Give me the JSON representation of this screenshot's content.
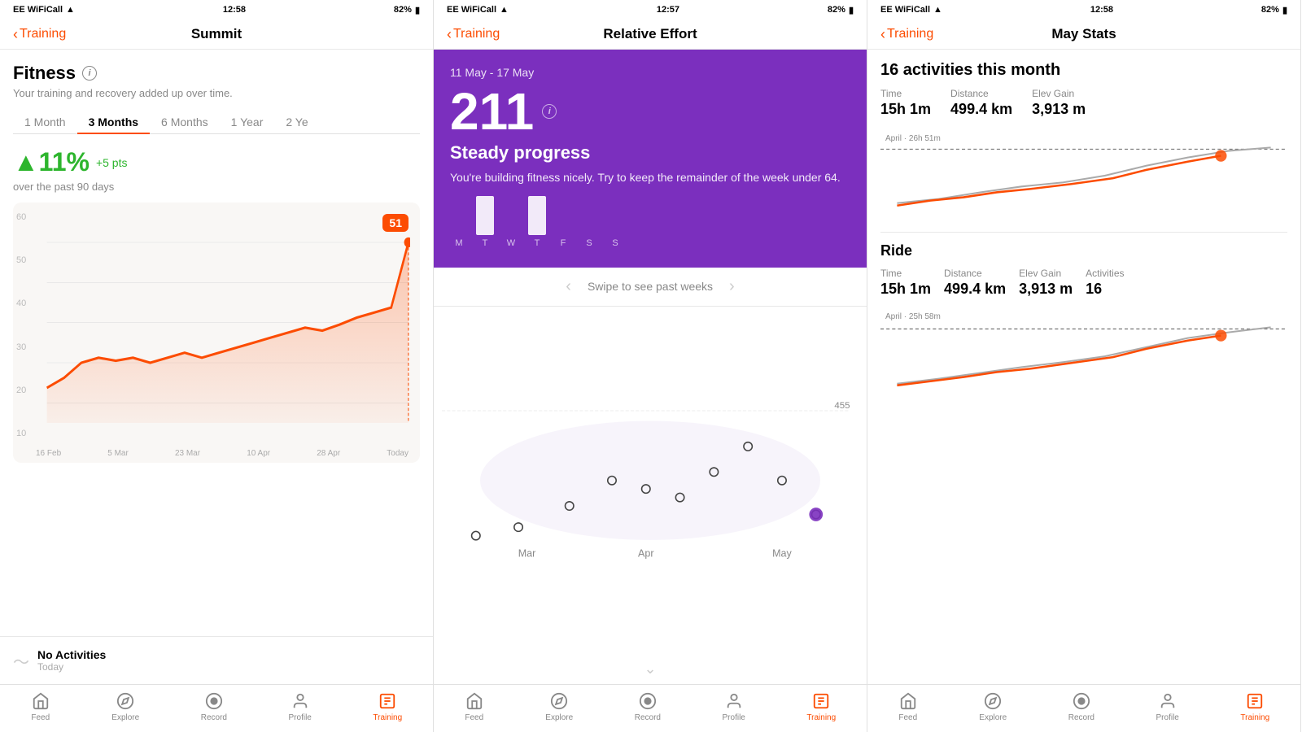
{
  "screens": [
    {
      "id": "summit",
      "statusBar": {
        "carrier": "EE WiFiCall",
        "time": "12:58",
        "battery": "82%"
      },
      "navBack": "Training",
      "navTitle": "Summit",
      "fitness": {
        "title": "Fitness",
        "subtitle": "Your training and recovery added up over time.",
        "tabs": [
          "1 Month",
          "3 Months",
          "6 Months",
          "1 Year",
          "2 Ye"
        ],
        "activeTab": 1,
        "changePercent": "▲11%",
        "changePts": "+5 pts",
        "changeLabel": "over the past 90 days",
        "currentValue": "51",
        "chartYLabels": [
          "60",
          "50",
          "40",
          "30",
          "20",
          "10"
        ],
        "chartXLabels": [
          "16 Feb",
          "5 Mar",
          "23 Mar",
          "10 Apr",
          "28 Apr",
          "Today"
        ]
      },
      "noActivities": {
        "title": "No Activities",
        "subtitle": "Today"
      },
      "tabBar": {
        "items": [
          {
            "label": "Feed",
            "icon": "home"
          },
          {
            "label": "Explore",
            "icon": "compass"
          },
          {
            "label": "Record",
            "icon": "record"
          },
          {
            "label": "Profile",
            "icon": "profile"
          },
          {
            "label": "Training",
            "icon": "training",
            "active": true
          }
        ]
      }
    },
    {
      "id": "relative-effort",
      "statusBar": {
        "carrier": "EE WiFiCall",
        "time": "12:57",
        "battery": "82%"
      },
      "navBack": "Training",
      "navTitle": "Relative Effort",
      "purpleCard": {
        "dateRange": "11 May - 17 May",
        "score": "211",
        "progressLabel": "Steady progress",
        "description": "You're building fitness nicely. Try to keep the remainder of the week under 64.",
        "weekBars": [
          {
            "day": "M",
            "height": 0
          },
          {
            "day": "T",
            "height": 50
          },
          {
            "day": "W",
            "height": 0
          },
          {
            "day": "T",
            "height": 50
          },
          {
            "day": "F",
            "height": 0
          },
          {
            "day": "S",
            "height": 0
          },
          {
            "day": "S",
            "height": 0
          }
        ]
      },
      "swipeText": "Swipe to see past weeks",
      "scatterYLabel": "455",
      "scatterXLabels": [
        "Mar",
        "Apr",
        "May"
      ],
      "tabBar": {
        "items": [
          {
            "label": "Feed",
            "icon": "home"
          },
          {
            "label": "Explore",
            "icon": "compass"
          },
          {
            "label": "Record",
            "icon": "record"
          },
          {
            "label": "Profile",
            "icon": "profile"
          },
          {
            "label": "Training",
            "icon": "training",
            "active": true
          }
        ]
      }
    },
    {
      "id": "may-stats",
      "statusBar": {
        "carrier": "EE WiFiCall",
        "time": "12:58",
        "battery": "82%"
      },
      "navBack": "Training",
      "navTitle": "May Stats",
      "monthStats": {
        "title": "16 activities this month",
        "stats": [
          {
            "label": "Time",
            "value": "15h 1m"
          },
          {
            "label": "Distance",
            "value": "499.4 km"
          },
          {
            "label": "Elev Gain",
            "value": "3,913 m"
          }
        ],
        "aprilLine": "April · 26h 51m"
      },
      "rideStats": {
        "title": "Ride",
        "stats": [
          {
            "label": "Time",
            "value": "15h 1m"
          },
          {
            "label": "Distance",
            "value": "499.4 km"
          },
          {
            "label": "Elev Gain",
            "value": "3,913 m"
          },
          {
            "label": "Activities",
            "value": "16"
          }
        ],
        "aprilLine": "April · 25h 58m"
      },
      "tabBar": {
        "items": [
          {
            "label": "Feed",
            "icon": "home"
          },
          {
            "label": "Explore",
            "icon": "compass"
          },
          {
            "label": "Record",
            "icon": "record"
          },
          {
            "label": "Profile",
            "icon": "profile"
          },
          {
            "label": "Training",
            "icon": "training",
            "active": true
          }
        ]
      }
    }
  ]
}
